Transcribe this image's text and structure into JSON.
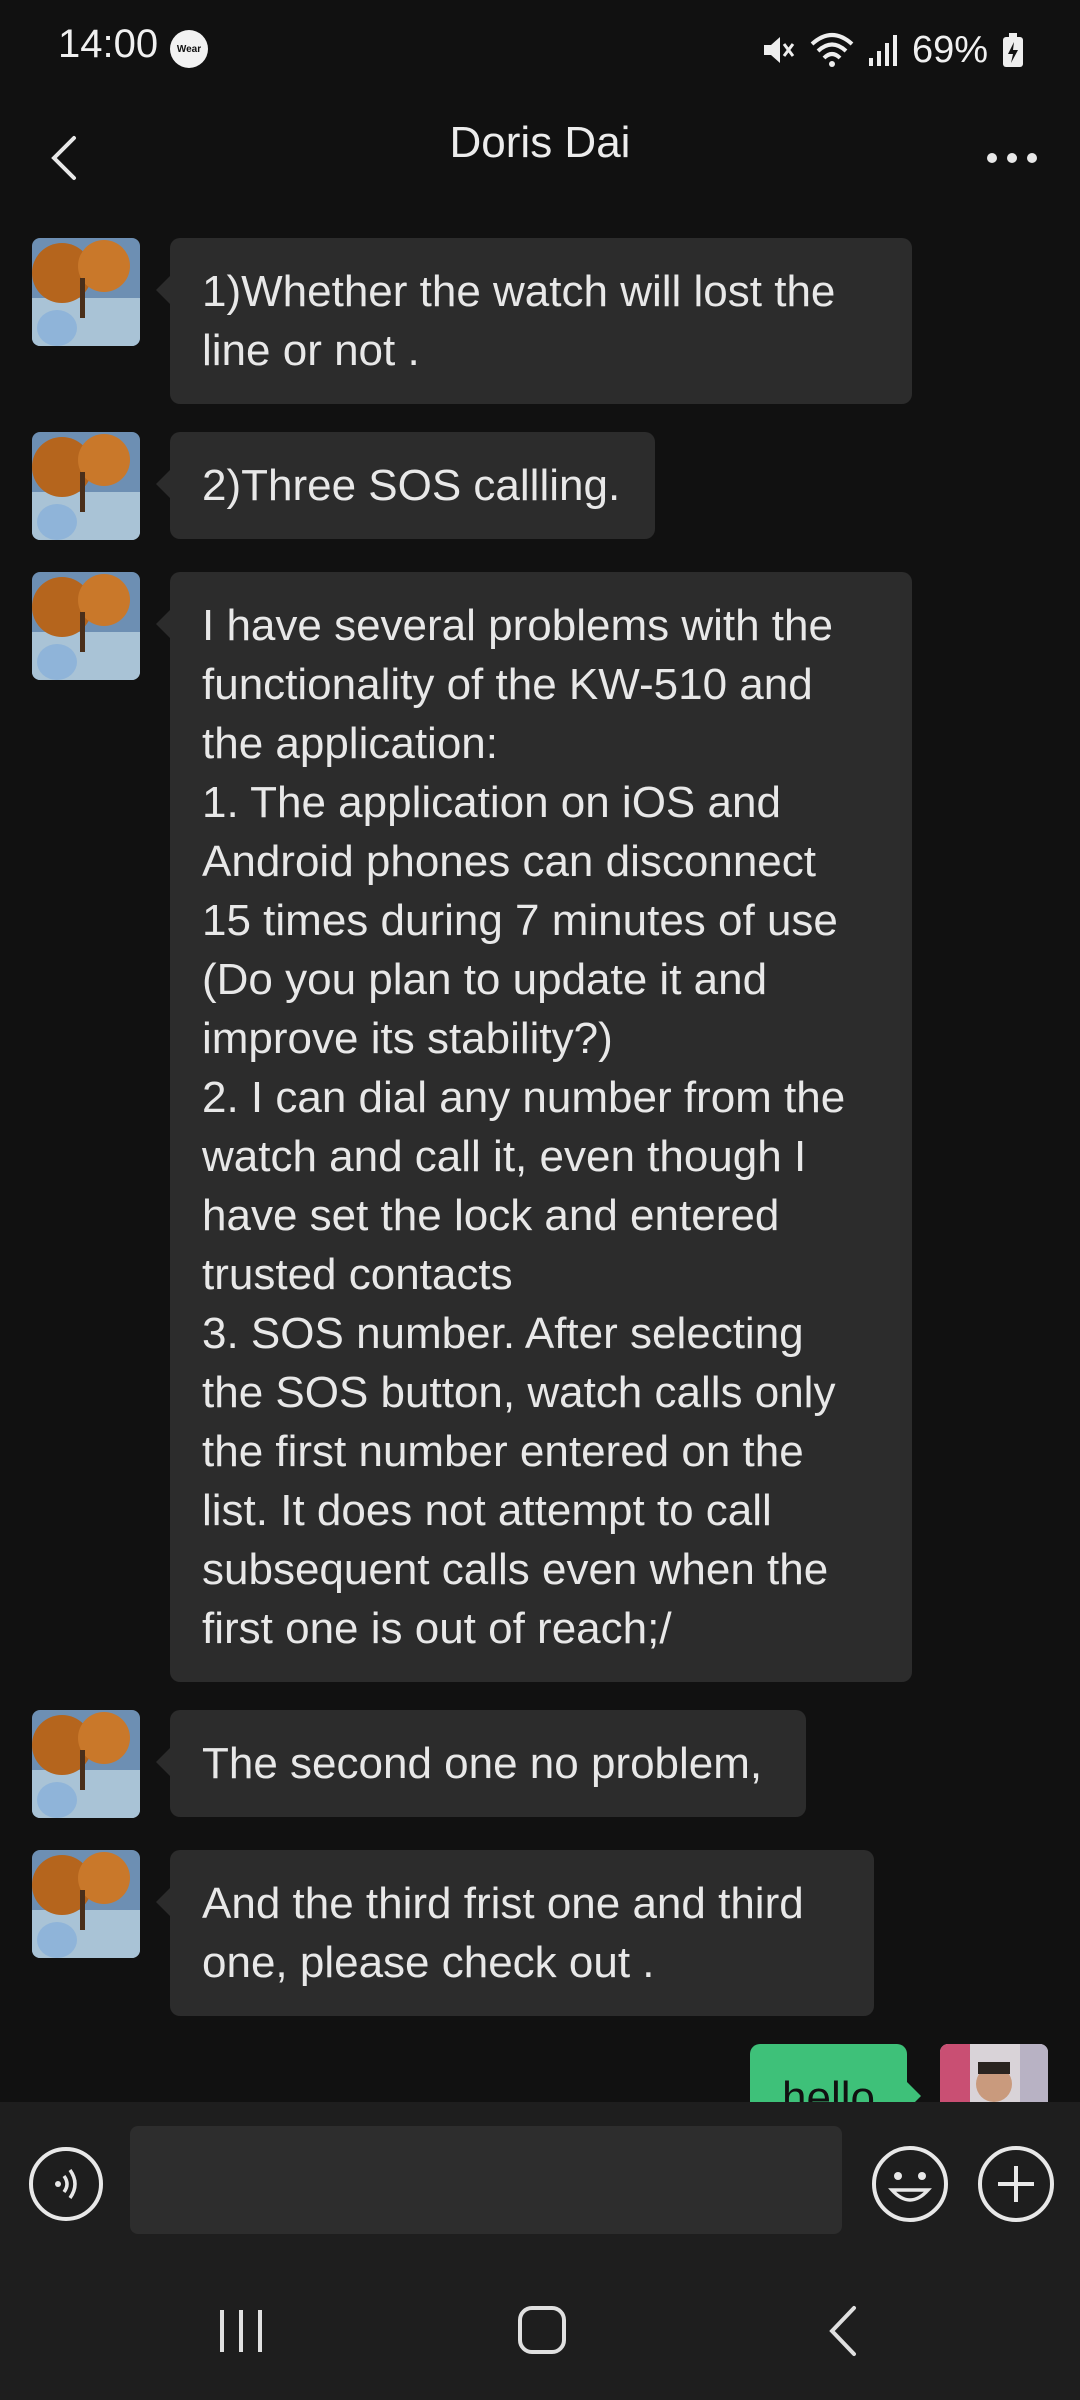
{
  "status_bar": {
    "time": "14:00",
    "wear_badge": "Wear",
    "battery": "69%",
    "icons": [
      "mute-icon",
      "wifi-icon",
      "signal-icon",
      "battery-charging-icon"
    ]
  },
  "header": {
    "title": "Doris Dai",
    "back_icon": "chevron-left-icon",
    "more_icon": "more-dots-icon"
  },
  "messages": [
    {
      "sender": "other",
      "text": "1)Whether the watch will lost the\nline or not ."
    },
    {
      "sender": "other",
      "text": "2)Three SOS callling."
    },
    {
      "sender": "other",
      "text": "I have several problems with the\nfunctionality of the KW-510 and\nthe application:\n1. The application on iOS and\nAndroid phones can disconnect\n15 times during 7 minutes of use\n(Do you plan to update it and\nimprove its stability?)\n2. I can dial any number from the\nwatch and call it, even though I\nhave set the lock and entered\ntrusted contacts\n3. SOS number. After selecting\nthe SOS button, watch calls only\nthe first number entered on the\nlist. It does not attempt to call\nsubsequent calls even when the\nfirst one is out of reach;/"
    },
    {
      "sender": "other",
      "text": "The second one no problem,"
    },
    {
      "sender": "other",
      "text": "And the third frist one and third\none, please check out ."
    },
    {
      "sender": "self",
      "text": "hello"
    }
  ],
  "input_bar": {
    "placeholder": "",
    "value": "",
    "icons": [
      "voice-icon",
      "emoji-icon",
      "plus-icon"
    ]
  },
  "nav_bar": {
    "icons": [
      "recents-icon",
      "home-icon",
      "back-icon"
    ]
  },
  "colors": {
    "background": "#111111",
    "bubble_other": "#2c2c2c",
    "bubble_self": "#3ec179",
    "bar": "#1e1e1e"
  }
}
